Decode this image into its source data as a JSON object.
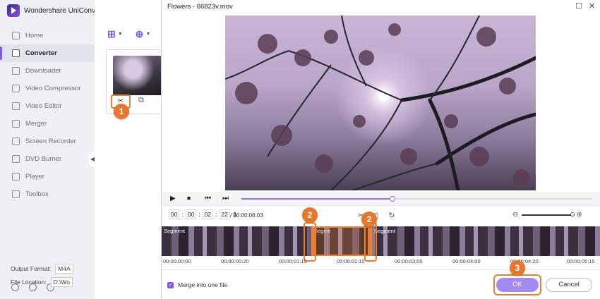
{
  "app": {
    "title": "Wondershare UniConverter"
  },
  "sidebar": {
    "items": [
      {
        "label": "Home",
        "icon": "home-icon",
        "active": false
      },
      {
        "label": "Converter",
        "icon": "converter-icon",
        "active": true
      },
      {
        "label": "Downloader",
        "icon": "download-icon",
        "active": false
      },
      {
        "label": "Video Compressor",
        "icon": "compress-icon",
        "active": false
      },
      {
        "label": "Video Editor",
        "icon": "scissors-icon",
        "active": false
      },
      {
        "label": "Merger",
        "icon": "merge-icon",
        "active": false
      },
      {
        "label": "Screen Recorder",
        "icon": "record-icon",
        "active": false
      },
      {
        "label": "DVD Burner",
        "icon": "disc-icon",
        "active": false
      },
      {
        "label": "Player",
        "icon": "play-icon",
        "active": false
      },
      {
        "label": "Toolbox",
        "icon": "grid-icon",
        "active": false
      }
    ]
  },
  "main": {
    "output_format_label": "Output Format:",
    "output_format_value": "M4A",
    "file_location_label": "File Location:",
    "file_location_value": "D:\\Wo"
  },
  "dialog": {
    "title": "Flowers - 66823v.mov",
    "time": {
      "h": "00",
      "m": "00",
      "s": "02",
      "f": "22"
    },
    "total": "/ 00:00:06:03",
    "segments": [
      "Segment",
      "Segme",
      "Segment"
    ],
    "ruler": [
      "00:00:00:00",
      "00:00:00:20",
      "00:00:01:15",
      "00:00:02:10",
      "00:00:03:05",
      "00:00:04:00",
      "00:00:04:20",
      "00:00:05:15"
    ],
    "merge_label": "Merge into one file",
    "ok_label": "OK",
    "cancel_label": "Cancel",
    "playback_progress": 0.5
  },
  "badges": [
    "1",
    "2",
    "2",
    "3"
  ],
  "colors": {
    "accent": "#7b5ce8",
    "highlight": "#f07e2d",
    "ok_button": "#a38af0"
  }
}
